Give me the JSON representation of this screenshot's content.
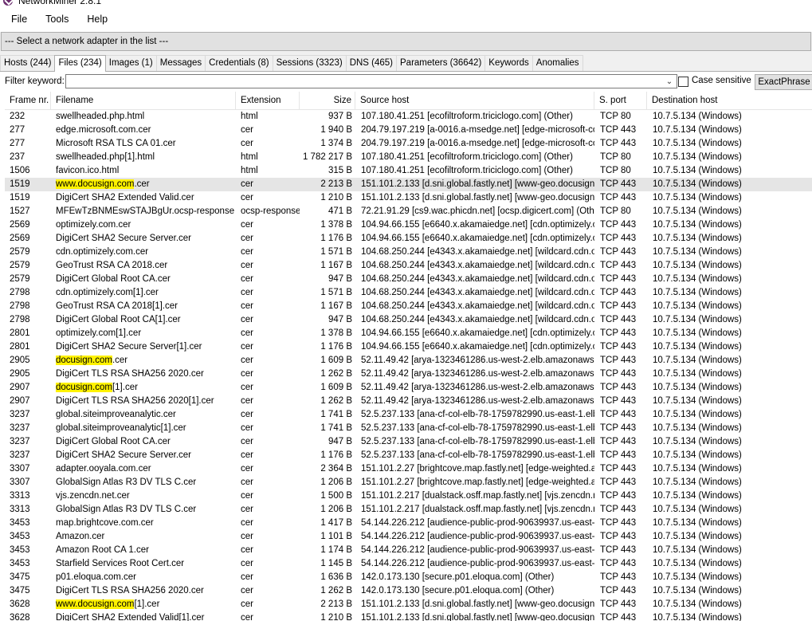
{
  "app": {
    "title": "NetworkMiner 2.8.1"
  },
  "menu": [
    "File",
    "Tools",
    "Help"
  ],
  "adapter": {
    "text": "--- Select a network adapter in the list ---"
  },
  "tabs": [
    "Hosts (244)",
    "Files (234)",
    "Images (1)",
    "Messages",
    "Credentials (8)",
    "Sessions (3323)",
    "DNS (465)",
    "Parameters (36642)",
    "Keywords",
    "Anomalies"
  ],
  "active_tab": 1,
  "filter": {
    "label": "Filter keyword:",
    "value": "",
    "case_sensitive_label": "Case sensitive",
    "case_sensitive_checked": false,
    "mode_button": "ExactPhrase"
  },
  "columns": [
    "Frame nr.",
    "Filename",
    "Extension",
    "Size",
    "Source host",
    "S. port",
    "Destination host"
  ],
  "selected_row": 5,
  "rows": [
    {
      "frame": "232",
      "name": "swellheaded.php.html",
      "ext": "html",
      "size": "937 B",
      "src": "107.180.41.251 [ecofiltroform.triciclogo.com] (Other)",
      "sport": "TCP 80",
      "dst": "10.7.5.134 (Windows)"
    },
    {
      "frame": "277",
      "name": "edge.microsoft.com.cer",
      "ext": "cer",
      "size": "1 940 B",
      "src": "204.79.197.219 [a-0016.a-msedge.net] [edge-microsoft-co...",
      "sport": "TCP 443",
      "dst": "10.7.5.134 (Windows)"
    },
    {
      "frame": "277",
      "name": "Microsoft RSA TLS CA 01.cer",
      "ext": "cer",
      "size": "1 374 B",
      "src": "204.79.197.219 [a-0016.a-msedge.net] [edge-microsoft-co...",
      "sport": "TCP 443",
      "dst": "10.7.5.134 (Windows)"
    },
    {
      "frame": "237",
      "name": "swellheaded.php[1].html",
      "ext": "html",
      "size": "1 782 217 B",
      "src": "107.180.41.251 [ecofiltroform.triciclogo.com] (Other)",
      "sport": "TCP 80",
      "dst": "10.7.5.134 (Windows)"
    },
    {
      "frame": "1506",
      "name": "favicon.ico.html",
      "ext": "html",
      "size": "315 B",
      "src": "107.180.41.251 [ecofiltroform.triciclogo.com] (Other)",
      "sport": "TCP 80",
      "dst": "10.7.5.134 (Windows)"
    },
    {
      "frame": "1519",
      "name": "www.docusign.com.cer",
      "hl": "www.docusign.com",
      "ext": "cer",
      "size": "2 213 B",
      "src": "151.101.2.133 [d.sni.global.fastly.net] [www-geo.docusign....",
      "sport": "TCP 443",
      "dst": "10.7.5.134 (Windows)"
    },
    {
      "frame": "1519",
      "name": "DigiCert SHA2 Extended Valid.cer",
      "ext": "cer",
      "size": "1 210 B",
      "src": "151.101.2.133 [d.sni.global.fastly.net] [www-geo.docusign....",
      "sport": "TCP 443",
      "dst": "10.7.5.134 (Windows)"
    },
    {
      "frame": "1527",
      "name": "MFEwTzBNMEswSTAJBgUr.ocsp-response",
      "ext": "ocsp-response",
      "size": "471 B",
      "src": "72.21.91.29 [cs9.wac.phicdn.net] [ocsp.digicert.com] (Other)",
      "sport": "TCP 80",
      "dst": "10.7.5.134 (Windows)"
    },
    {
      "frame": "2569",
      "name": "optimizely.com.cer",
      "ext": "cer",
      "size": "1 378 B",
      "src": "104.94.66.155 [e6640.x.akamaiedge.net] [cdn.optimizely.c...",
      "sport": "TCP 443",
      "dst": "10.7.5.134 (Windows)"
    },
    {
      "frame": "2569",
      "name": "DigiCert SHA2 Secure Server.cer",
      "ext": "cer",
      "size": "1 176 B",
      "src": "104.94.66.155 [e6640.x.akamaiedge.net] [cdn.optimizely.c...",
      "sport": "TCP 443",
      "dst": "10.7.5.134 (Windows)"
    },
    {
      "frame": "2579",
      "name": "cdn.optimizely.com.cer",
      "ext": "cer",
      "size": "1 571 B",
      "src": "104.68.250.244 [e4343.x.akamaiedge.net] [wildcard.cdn.o...",
      "sport": "TCP 443",
      "dst": "10.7.5.134 (Windows)"
    },
    {
      "frame": "2579",
      "name": "GeoTrust RSA CA 2018.cer",
      "ext": "cer",
      "size": "1 167 B",
      "src": "104.68.250.244 [e4343.x.akamaiedge.net] [wildcard.cdn.o...",
      "sport": "TCP 443",
      "dst": "10.7.5.134 (Windows)"
    },
    {
      "frame": "2579",
      "name": "DigiCert Global Root CA.cer",
      "ext": "cer",
      "size": "947 B",
      "src": "104.68.250.244 [e4343.x.akamaiedge.net] [wildcard.cdn.o...",
      "sport": "TCP 443",
      "dst": "10.7.5.134 (Windows)"
    },
    {
      "frame": "2798",
      "name": "cdn.optimizely.com[1].cer",
      "ext": "cer",
      "size": "1 571 B",
      "src": "104.68.250.244 [e4343.x.akamaiedge.net] [wildcard.cdn.o...",
      "sport": "TCP 443",
      "dst": "10.7.5.134 (Windows)"
    },
    {
      "frame": "2798",
      "name": "GeoTrust RSA CA 2018[1].cer",
      "ext": "cer",
      "size": "1 167 B",
      "src": "104.68.250.244 [e4343.x.akamaiedge.net] [wildcard.cdn.o...",
      "sport": "TCP 443",
      "dst": "10.7.5.134 (Windows)"
    },
    {
      "frame": "2798",
      "name": "DigiCert Global Root CA[1].cer",
      "ext": "cer",
      "size": "947 B",
      "src": "104.68.250.244 [e4343.x.akamaiedge.net] [wildcard.cdn.o...",
      "sport": "TCP 443",
      "dst": "10.7.5.134 (Windows)"
    },
    {
      "frame": "2801",
      "name": "optimizely.com[1].cer",
      "ext": "cer",
      "size": "1 378 B",
      "src": "104.94.66.155 [e6640.x.akamaiedge.net] [cdn.optimizely.c...",
      "sport": "TCP 443",
      "dst": "10.7.5.134 (Windows)"
    },
    {
      "frame": "2801",
      "name": "DigiCert SHA2 Secure Server[1].cer",
      "ext": "cer",
      "size": "1 176 B",
      "src": "104.94.66.155 [e6640.x.akamaiedge.net] [cdn.optimizely.c...",
      "sport": "TCP 443",
      "dst": "10.7.5.134 (Windows)"
    },
    {
      "frame": "2905",
      "name": "docusign.com.cer",
      "hl": "docusign.com",
      "ext": "cer",
      "size": "1 609 B",
      "src": "52.11.49.42 [arya-1323461286.us-west-2.elb.amazonaws.c...",
      "sport": "TCP 443",
      "dst": "10.7.5.134 (Windows)"
    },
    {
      "frame": "2905",
      "name": "DigiCert TLS RSA SHA256 2020.cer",
      "ext": "cer",
      "size": "1 262 B",
      "src": "52.11.49.42 [arya-1323461286.us-west-2.elb.amazonaws.c...",
      "sport": "TCP 443",
      "dst": "10.7.5.134 (Windows)"
    },
    {
      "frame": "2907",
      "name": "docusign.com[1].cer",
      "hl": "docusign.com",
      "ext": "cer",
      "size": "1 609 B",
      "src": "52.11.49.42 [arya-1323461286.us-west-2.elb.amazonaws.c...",
      "sport": "TCP 443",
      "dst": "10.7.5.134 (Windows)"
    },
    {
      "frame": "2907",
      "name": "DigiCert TLS RSA SHA256 2020[1].cer",
      "ext": "cer",
      "size": "1 262 B",
      "src": "52.11.49.42 [arya-1323461286.us-west-2.elb.amazonaws.c...",
      "sport": "TCP 443",
      "dst": "10.7.5.134 (Windows)"
    },
    {
      "frame": "3237",
      "name": "global.siteimproveanalytic.cer",
      "ext": "cer",
      "size": "1 741 B",
      "src": "52.5.237.133 [ana-cf-col-elb-78-1759782990.us-east-1.elb....",
      "sport": "TCP 443",
      "dst": "10.7.5.134 (Windows)"
    },
    {
      "frame": "3237",
      "name": "global.siteimproveanalytic[1].cer",
      "ext": "cer",
      "size": "1 741 B",
      "src": "52.5.237.133 [ana-cf-col-elb-78-1759782990.us-east-1.elb....",
      "sport": "TCP 443",
      "dst": "10.7.5.134 (Windows)"
    },
    {
      "frame": "3237",
      "name": "DigiCert Global Root CA.cer",
      "ext": "cer",
      "size": "947 B",
      "src": "52.5.237.133 [ana-cf-col-elb-78-1759782990.us-east-1.elb....",
      "sport": "TCP 443",
      "dst": "10.7.5.134 (Windows)"
    },
    {
      "frame": "3237",
      "name": "DigiCert SHA2 Secure Server.cer",
      "ext": "cer",
      "size": "1 176 B",
      "src": "52.5.237.133 [ana-cf-col-elb-78-1759782990.us-east-1.elb....",
      "sport": "TCP 443",
      "dst": "10.7.5.134 (Windows)"
    },
    {
      "frame": "3307",
      "name": "adapter.ooyala.com.cer",
      "ext": "cer",
      "size": "2 364 B",
      "src": "151.101.2.27 [brightcove.map.fastly.net] [edge-weighted.a...",
      "sport": "TCP 443",
      "dst": "10.7.5.134 (Windows)"
    },
    {
      "frame": "3307",
      "name": "GlobalSign Atlas R3 DV TLS C.cer",
      "ext": "cer",
      "size": "1 206 B",
      "src": "151.101.2.27 [brightcove.map.fastly.net] [edge-weighted.a...",
      "sport": "TCP 443",
      "dst": "10.7.5.134 (Windows)"
    },
    {
      "frame": "3313",
      "name": "vjs.zencdn.net.cer",
      "ext": "cer",
      "size": "1 500 B",
      "src": "151.101.2.217 [dualstack.osff.map.fastly.net] [vjs.zencdn.n...",
      "sport": "TCP 443",
      "dst": "10.7.5.134 (Windows)"
    },
    {
      "frame": "3313",
      "name": "GlobalSign Atlas R3 DV TLS C.cer",
      "ext": "cer",
      "size": "1 206 B",
      "src": "151.101.2.217 [dualstack.osff.map.fastly.net] [vjs.zencdn.n...",
      "sport": "TCP 443",
      "dst": "10.7.5.134 (Windows)"
    },
    {
      "frame": "3453",
      "name": "map.brightcove.com.cer",
      "ext": "cer",
      "size": "1 417 B",
      "src": "54.144.226.212 [audience-public-prod-90639937.us-east-1...",
      "sport": "TCP 443",
      "dst": "10.7.5.134 (Windows)"
    },
    {
      "frame": "3453",
      "name": "Amazon.cer",
      "ext": "cer",
      "size": "1 101 B",
      "src": "54.144.226.212 [audience-public-prod-90639937.us-east-1...",
      "sport": "TCP 443",
      "dst": "10.7.5.134 (Windows)"
    },
    {
      "frame": "3453",
      "name": "Amazon Root CA 1.cer",
      "ext": "cer",
      "size": "1 174 B",
      "src": "54.144.226.212 [audience-public-prod-90639937.us-east-1...",
      "sport": "TCP 443",
      "dst": "10.7.5.134 (Windows)"
    },
    {
      "frame": "3453",
      "name": "Starfield Services Root Cert.cer",
      "ext": "cer",
      "size": "1 145 B",
      "src": "54.144.226.212 [audience-public-prod-90639937.us-east-1...",
      "sport": "TCP 443",
      "dst": "10.7.5.134 (Windows)"
    },
    {
      "frame": "3475",
      "name": "p01.eloqua.com.cer",
      "ext": "cer",
      "size": "1 636 B",
      "src": "142.0.173.130 [secure.p01.eloqua.com] (Other)",
      "sport": "TCP 443",
      "dst": "10.7.5.134 (Windows)"
    },
    {
      "frame": "3475",
      "name": "DigiCert TLS RSA SHA256 2020.cer",
      "ext": "cer",
      "size": "1 262 B",
      "src": "142.0.173.130 [secure.p01.eloqua.com] (Other)",
      "sport": "TCP 443",
      "dst": "10.7.5.134 (Windows)"
    },
    {
      "frame": "3628",
      "name": "www.docusign.com[1].cer",
      "hl": "www.docusign.com",
      "ext": "cer",
      "size": "2 213 B",
      "src": "151.101.2.133 [d.sni.global.fastly.net] [www-geo.docusign....",
      "sport": "TCP 443",
      "dst": "10.7.5.134 (Windows)"
    },
    {
      "frame": "3628",
      "name": "DigiCert SHA2 Extended Valid[1].cer",
      "ext": "cer",
      "size": "1 210 B",
      "src": "151.101.2.133 [d.sni.global.fastly.net] [www-geo.docusign....",
      "sport": "TCP 443",
      "dst": "10.7.5.134 (Windows)"
    }
  ]
}
